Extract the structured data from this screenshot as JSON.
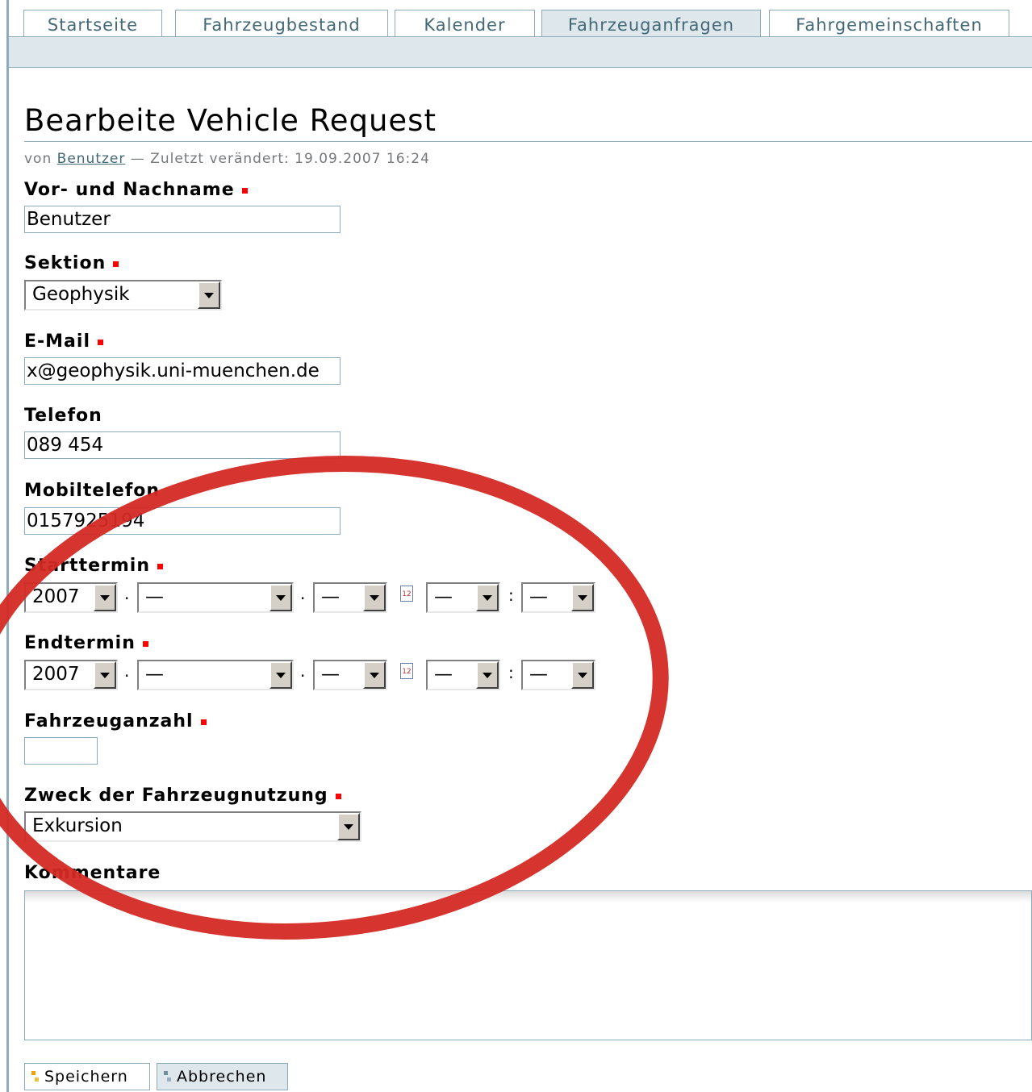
{
  "tabs": [
    {
      "label": "Startseite",
      "active": false
    },
    {
      "label": "Fahrzeugbestand",
      "active": false
    },
    {
      "label": "Kalender",
      "active": false
    },
    {
      "label": "Fahrzeuganfragen",
      "active": true
    },
    {
      "label": "Fahrgemeinschaften",
      "active": false
    }
  ],
  "page": {
    "title": "Bearbeite Vehicle Request",
    "byline_prefix": "von",
    "byline_author": "Benutzer",
    "byline_suffix": "— Zuletzt verändert: 19.09.2007 16:24"
  },
  "form": {
    "name": {
      "label": "Vor- und Nachname",
      "value": "Benutzer",
      "required": true
    },
    "section": {
      "label": "Sektion",
      "value": "Geophysik",
      "required": true
    },
    "email": {
      "label": "E-Mail",
      "value": "x@geophysik.uni-muenchen.de",
      "required": true
    },
    "phone": {
      "label": "Telefon",
      "value": "089 454",
      "required": false
    },
    "mobile": {
      "label": "Mobiltelefon",
      "value": "0157925194",
      "required": false
    },
    "start": {
      "label": "Starttermin",
      "year": "2007",
      "month": "—",
      "day": "—",
      "hour": "—",
      "minute": "—",
      "required": true
    },
    "end": {
      "label": "Endtermin",
      "year": "2007",
      "month": "—",
      "day": "—",
      "hour": "—",
      "minute": "—",
      "required": true
    },
    "vehicle_count": {
      "label": "Fahrzeuganzahl",
      "value": "",
      "required": true
    },
    "purpose": {
      "label": "Zweck der Fahrzeugnutzung",
      "value": "Exkursion",
      "required": true
    },
    "comments": {
      "label": "Kommentare",
      "value": ""
    },
    "date_sep": "·",
    "time_sep": ":"
  },
  "buttons": {
    "save": "Speichern",
    "cancel": "Abbrechen"
  },
  "colors": {
    "accent": "#8cacbb",
    "required": "#ff0000",
    "annotation": "#d42a24"
  }
}
